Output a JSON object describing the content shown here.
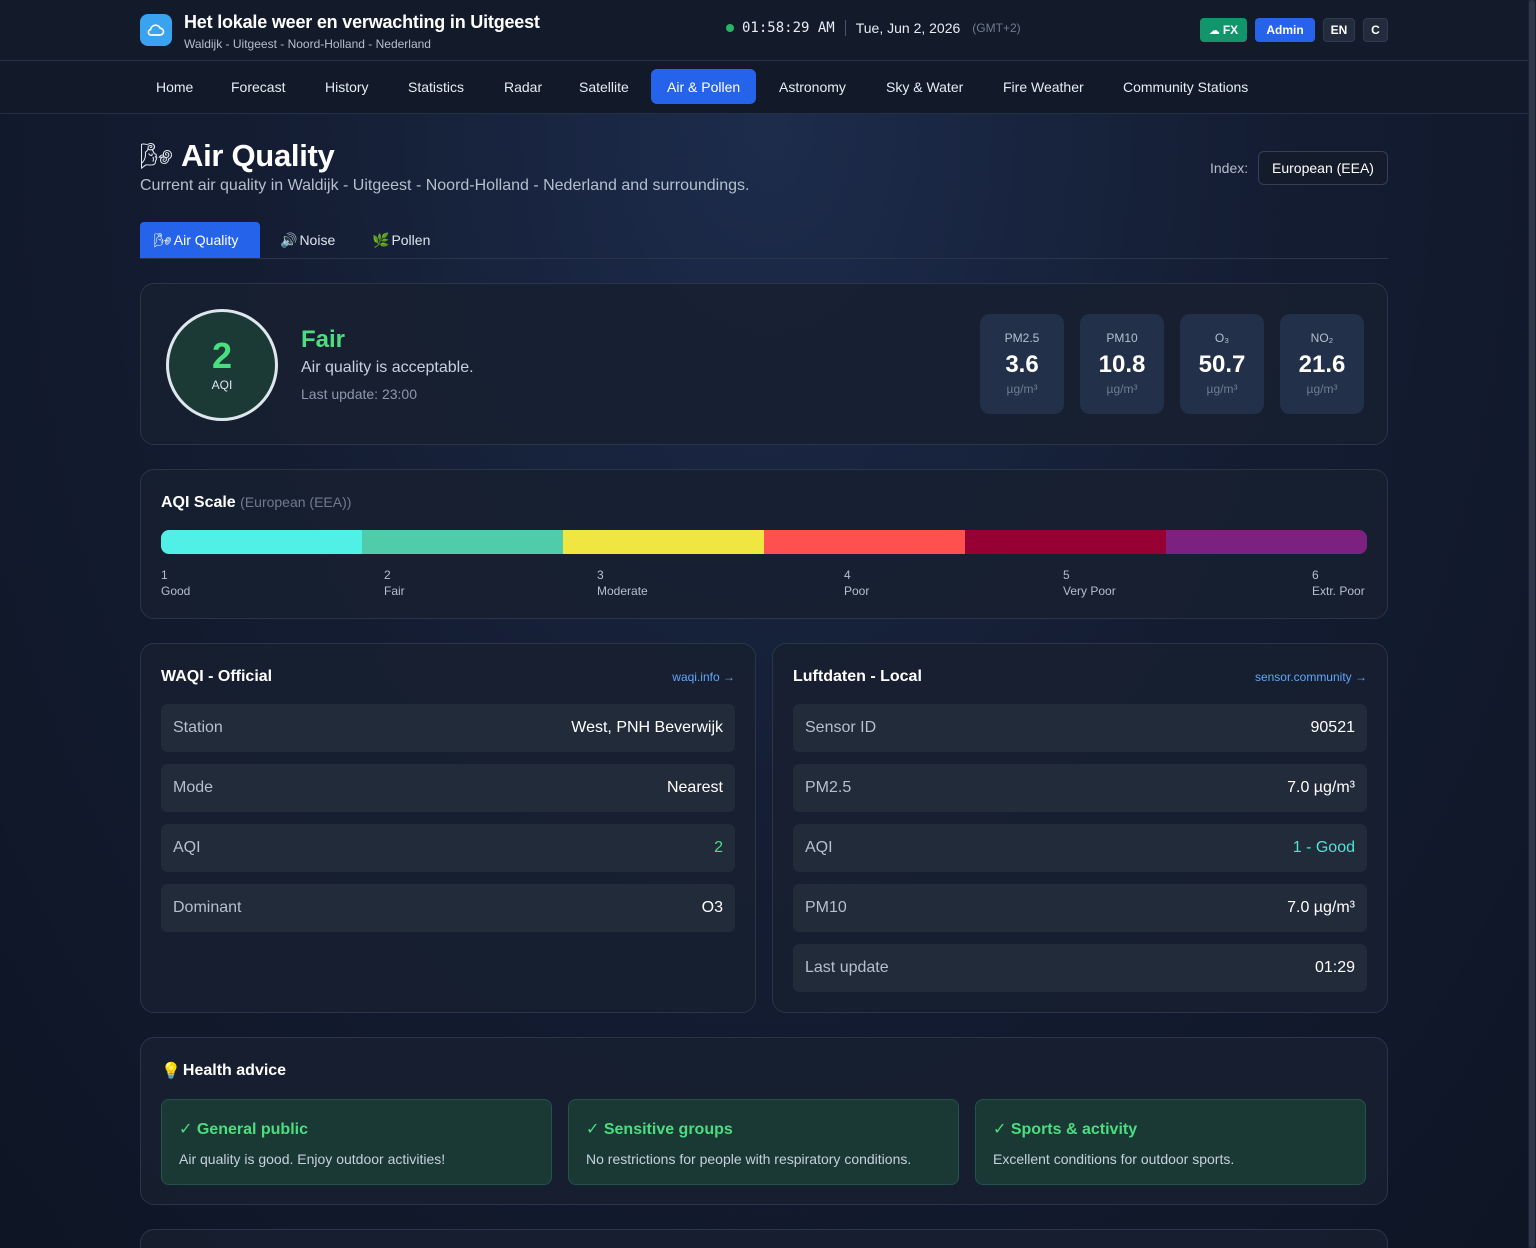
{
  "header": {
    "title": "Het lokale weer en verwachting in Uitgeest",
    "subtitle": "Waldijk - Uitgeest - Noord-Holland - Nederland",
    "time": "01:58:29 AM",
    "date": "Tue, Jun 2, 2026",
    "timezone": "(GMT+2)",
    "fx_label": "FX",
    "admin_label": "Admin",
    "lang_label": "EN",
    "unit_label": "C"
  },
  "nav": {
    "items": [
      "Home",
      "Forecast",
      "History",
      "Statistics",
      "Radar",
      "Satellite",
      "Air & Pollen",
      "Astronomy",
      "Sky & Water",
      "Fire Weather",
      "Community Stations"
    ],
    "active": "Air & Pollen"
  },
  "page": {
    "icon": "🌬",
    "title": "Air Quality",
    "subtitle": "Current air quality in Waldijk - Uitgeest - Noord-Holland - Nederland and surroundings.",
    "index_label": "Index:",
    "index_value": "European (EEA)"
  },
  "tabs": [
    {
      "icon": "🌬",
      "label": "Air Quality"
    },
    {
      "icon": "🔊",
      "label": "Noise"
    },
    {
      "icon": "🌿",
      "label": "Pollen"
    }
  ],
  "aqi": {
    "value": "2",
    "unit": "AQI",
    "level": "Fair",
    "description": "Air quality is acceptable.",
    "last_update": "Last update: 23:00",
    "pollutants": [
      {
        "name": "PM2.5",
        "value": "3.6",
        "unit": "µg/m³"
      },
      {
        "name": "PM10",
        "value": "10.8",
        "unit": "µg/m³"
      },
      {
        "name": "O₃",
        "value": "50.7",
        "unit": "µg/m³"
      },
      {
        "name": "NO₂",
        "value": "21.6",
        "unit": "µg/m³"
      }
    ]
  },
  "scale": {
    "title": "AQI Scale",
    "index": "(European (EEA))",
    "levels": [
      {
        "num": "1",
        "label": "Good",
        "color": "#50f0e6"
      },
      {
        "num": "2",
        "label": "Fair",
        "color": "#50ccaa"
      },
      {
        "num": "3",
        "label": "Moderate",
        "color": "#f0e641"
      },
      {
        "num": "4",
        "label": "Poor",
        "color": "#ff5050"
      },
      {
        "num": "5",
        "label": "Very Poor",
        "color": "#960032"
      },
      {
        "num": "6",
        "label": "Extr. Poor",
        "color": "#7d2181"
      }
    ]
  },
  "waqi": {
    "title": "WAQI - Official",
    "link": "waqi.info →",
    "rows": [
      {
        "key": "Station",
        "value": "West, PNH Beverwijk"
      },
      {
        "key": "Mode",
        "value": "Nearest"
      },
      {
        "key": "AQI",
        "value": "2"
      },
      {
        "key": "Dominant",
        "value": "O3"
      }
    ]
  },
  "luftdaten": {
    "title": "Luftdaten - Local",
    "link": "sensor.community →",
    "rows": [
      {
        "key": "Sensor ID",
        "value": "90521"
      },
      {
        "key": "PM2.5",
        "value": "7.0 µg/m³"
      },
      {
        "key": "AQI",
        "value": "1 - Good"
      },
      {
        "key": "PM10",
        "value": "7.0 µg/m³"
      },
      {
        "key": "Last update",
        "value": "01:29"
      }
    ]
  },
  "health": {
    "icon": "💡",
    "title": "Health advice",
    "items": [
      {
        "title": "✓ General public",
        "text": "Air quality is good. Enjoy outdoor activities!"
      },
      {
        "title": "✓ Sensitive groups",
        "text": "No restrictions for people with respiratory conditions."
      },
      {
        "title": "✓ Sports & activity",
        "text": "Excellent conditions for outdoor sports."
      }
    ]
  }
}
